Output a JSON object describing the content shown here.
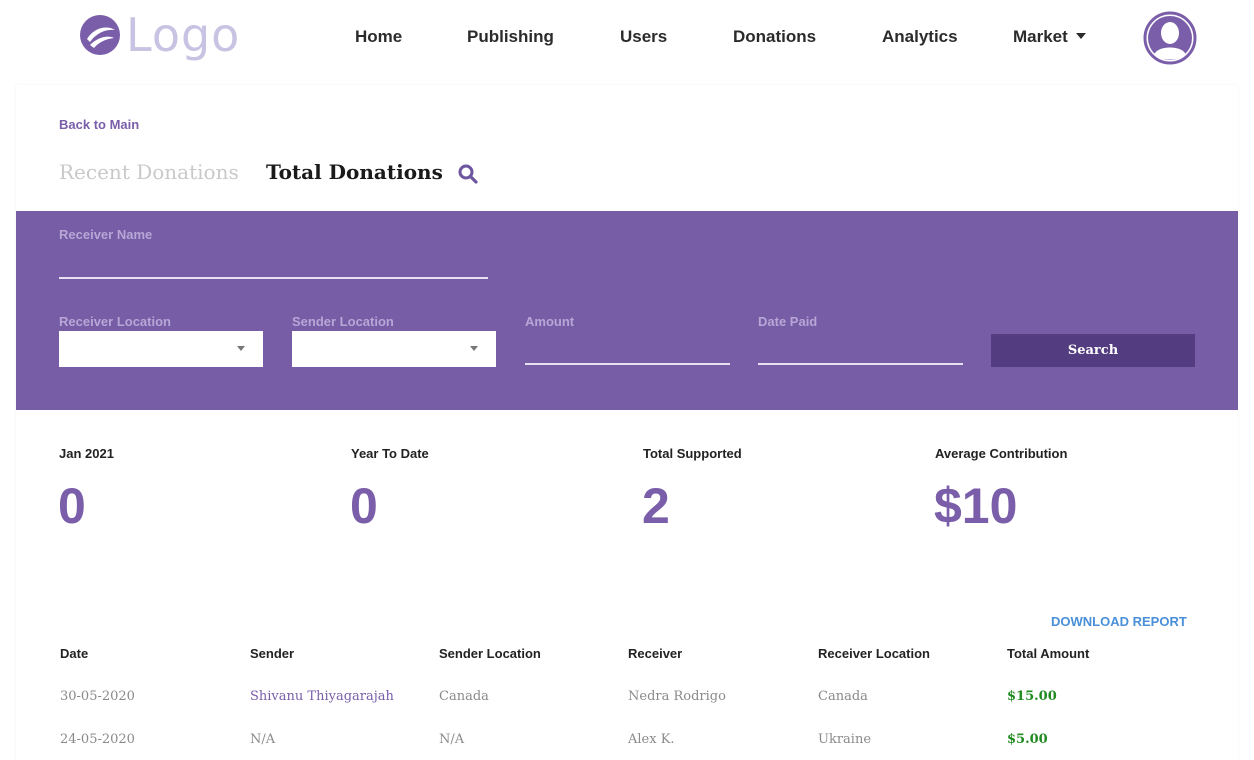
{
  "header": {
    "logo_text": "Logo",
    "nav": [
      {
        "label": "Home"
      },
      {
        "label": "Publishing"
      },
      {
        "label": "Users"
      },
      {
        "label": "Donations"
      },
      {
        "label": "Analytics"
      },
      {
        "label": "Market"
      }
    ]
  },
  "page": {
    "back_link": "Back to Main",
    "tabs": [
      {
        "label": "Recent Donations",
        "active": false
      },
      {
        "label": "Total Donations",
        "active": true
      }
    ]
  },
  "filters": {
    "receiver_name_label": "Receiver Name",
    "receiver_location_label": "Receiver Location",
    "sender_location_label": "Sender Location",
    "amount_label": "Amount",
    "date_paid_label": "Date Paid",
    "search_button": "Search"
  },
  "stats": [
    {
      "label": "Jan 2021",
      "value": "0"
    },
    {
      "label": "Year To Date",
      "value": "0"
    },
    {
      "label": "Total Supported",
      "value": "2"
    },
    {
      "label": "Average Contribution",
      "value": "$10"
    }
  ],
  "table": {
    "download_label": "DOWNLOAD REPORT",
    "headers": [
      "Date",
      "Sender",
      "Sender Location",
      "Receiver",
      "Receiver Location",
      "Total Amount"
    ],
    "rows": [
      [
        "30-05-2020",
        "Shivanu Thiyagarajah",
        "Canada",
        "Nedra Rodrigo",
        "Canada",
        "$15.00"
      ],
      [
        "24-05-2020",
        "N/A",
        "N/A",
        "Alex K.",
        "Ukraine",
        "$5.00"
      ]
    ]
  },
  "colors": {
    "accent": "#775ca6",
    "accent_dark": "#533c7f",
    "link_blue": "#4a90d9",
    "amount_green": "#1f8a1f"
  }
}
